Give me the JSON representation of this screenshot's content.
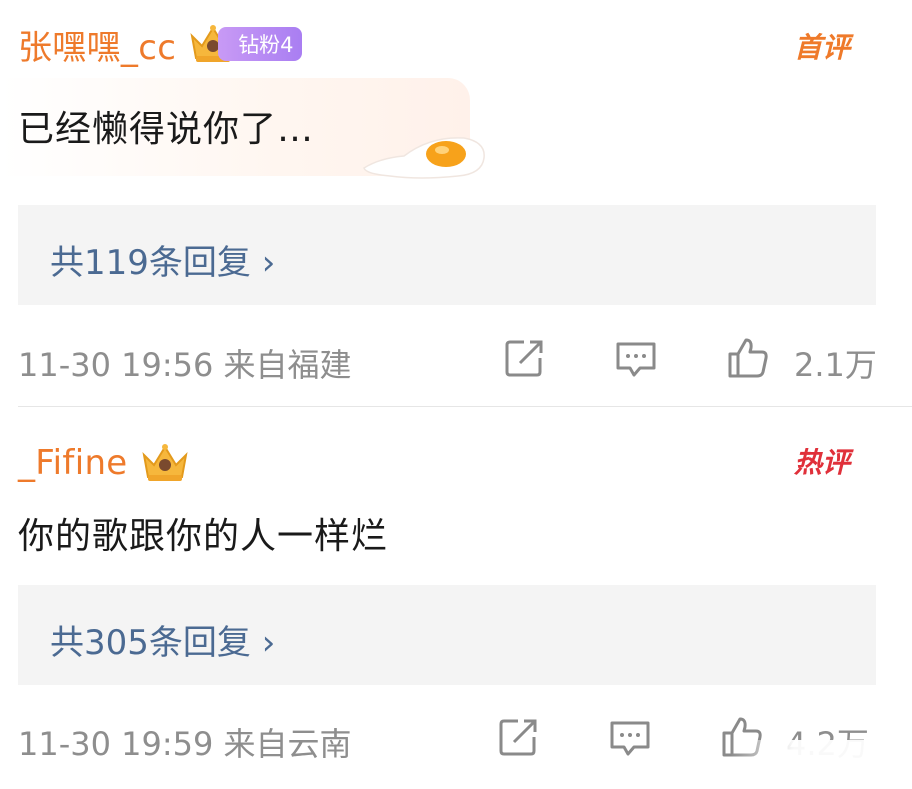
{
  "comments": [
    {
      "username": "张嘿嘿_cc",
      "fan_badge": "钻粉4",
      "tag": "首评",
      "content": "已经懒得说你了…",
      "replies": "共119条回复 ›",
      "meta": "11-30 19:56  来自福建",
      "likes": "2.1万"
    },
    {
      "username": "_Fifine",
      "tag": "热评",
      "content": "你的歌跟你的人一样烂",
      "replies": "共305条回复 ›",
      "meta": "11-30 19:59  来自云南",
      "likes": "4.2万"
    }
  ],
  "icons": [
    "crown-icon",
    "share-icon",
    "comment-icon",
    "like-icon",
    "egg-sticker"
  ],
  "colors": {
    "username": "#ee7a2b",
    "reply_link": "#4b6a92",
    "meta": "#8e8e8e",
    "hot": "#e0303a"
  }
}
